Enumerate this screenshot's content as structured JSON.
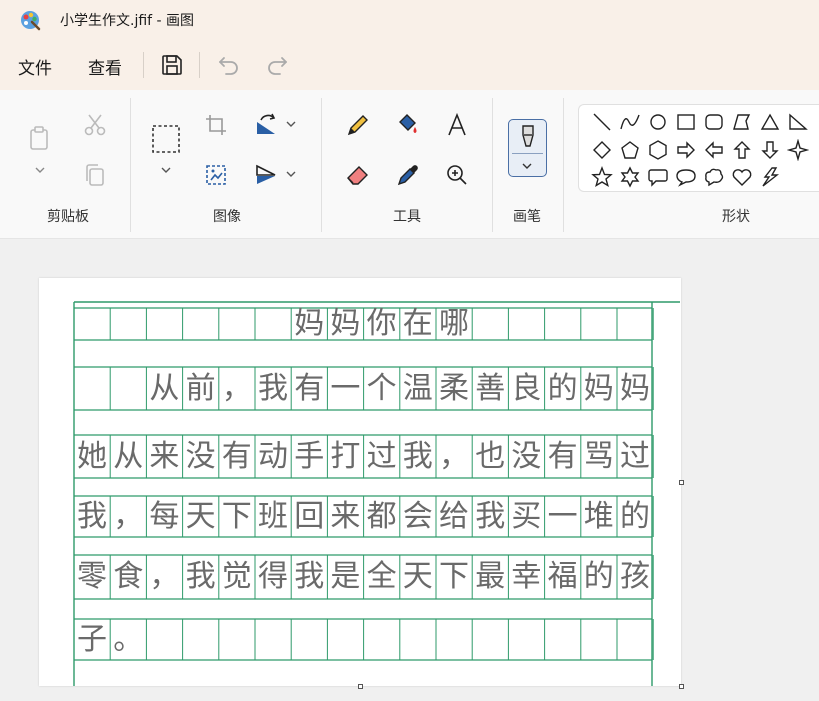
{
  "window": {
    "title": "小学生作文.jfif - 画图"
  },
  "menu": {
    "file": "文件",
    "view": "查看"
  },
  "ribbon": {
    "groups": {
      "clipboard": "剪贴板",
      "image": "图像",
      "tools": "工具",
      "brushes": "画笔",
      "shapes": "形状"
    }
  },
  "document": {
    "title": "妈妈你在哪",
    "rows": [
      [
        "",
        "",
        "从",
        "前",
        "，",
        "我",
        "有",
        "一",
        "个",
        "温",
        "柔",
        "善",
        "良",
        "的",
        "妈",
        "妈"
      ],
      [
        "她",
        "从",
        "来",
        "没",
        "有",
        "动",
        "手",
        "打",
        "过",
        "我",
        "，",
        "也",
        "没",
        "有",
        "骂",
        "过"
      ],
      [
        "我",
        "，",
        "每",
        "天",
        "下",
        "班",
        "回",
        "来",
        "都",
        "会",
        "给",
        "我",
        "买",
        "一",
        "堆",
        "的"
      ],
      [
        "零",
        "食",
        "，",
        "我",
        "觉",
        "得",
        "我",
        "是",
        "全",
        "天",
        "下",
        "最",
        "幸",
        "福",
        "的",
        "孩"
      ],
      [
        "子",
        "。"
      ]
    ]
  },
  "colors": {
    "grid": "#2e9a6a",
    "titlebar": "#f9f0e8",
    "accent": "#4a6fa5"
  }
}
